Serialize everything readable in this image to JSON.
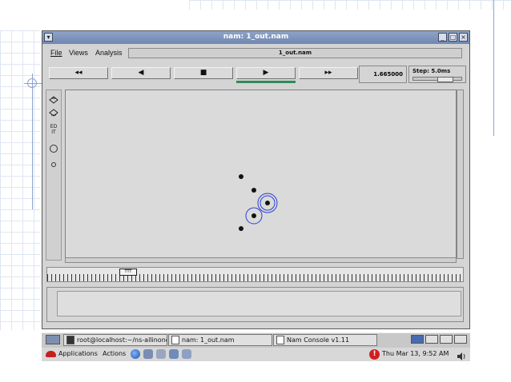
{
  "window": {
    "title": "nam: 1_out.nam",
    "menu": [
      "File",
      "Views",
      "Analysis"
    ],
    "filename": "1_out.nam",
    "controls": [
      {
        "label": "◂◂",
        "name": "fast-rewind-button"
      },
      {
        "label": "◀",
        "name": "rewind-button"
      },
      {
        "label": "■",
        "name": "stop-button"
      },
      {
        "label": "▶",
        "name": "play-button"
      },
      {
        "label": "▸▸",
        "name": "fast-forward-button"
      }
    ],
    "time": "1.665000",
    "step": "Step: 5.0ms",
    "tools": [
      "EDIT"
    ],
    "timeline_marker": "TTT"
  },
  "taskbar": {
    "tasks": [
      "root@localhost:~/ns-allinone-",
      "nam: 1_out.nam",
      "Nam Console v1.11"
    ]
  },
  "panel": {
    "applications": "Applications",
    "actions": "Actions",
    "clock": "Thu Mar 13,  9:52 AM"
  },
  "colors": {
    "title_bar": "#7a90b8",
    "accent_green": "#2e8b57",
    "node_ring": "#2b3fd6"
  }
}
